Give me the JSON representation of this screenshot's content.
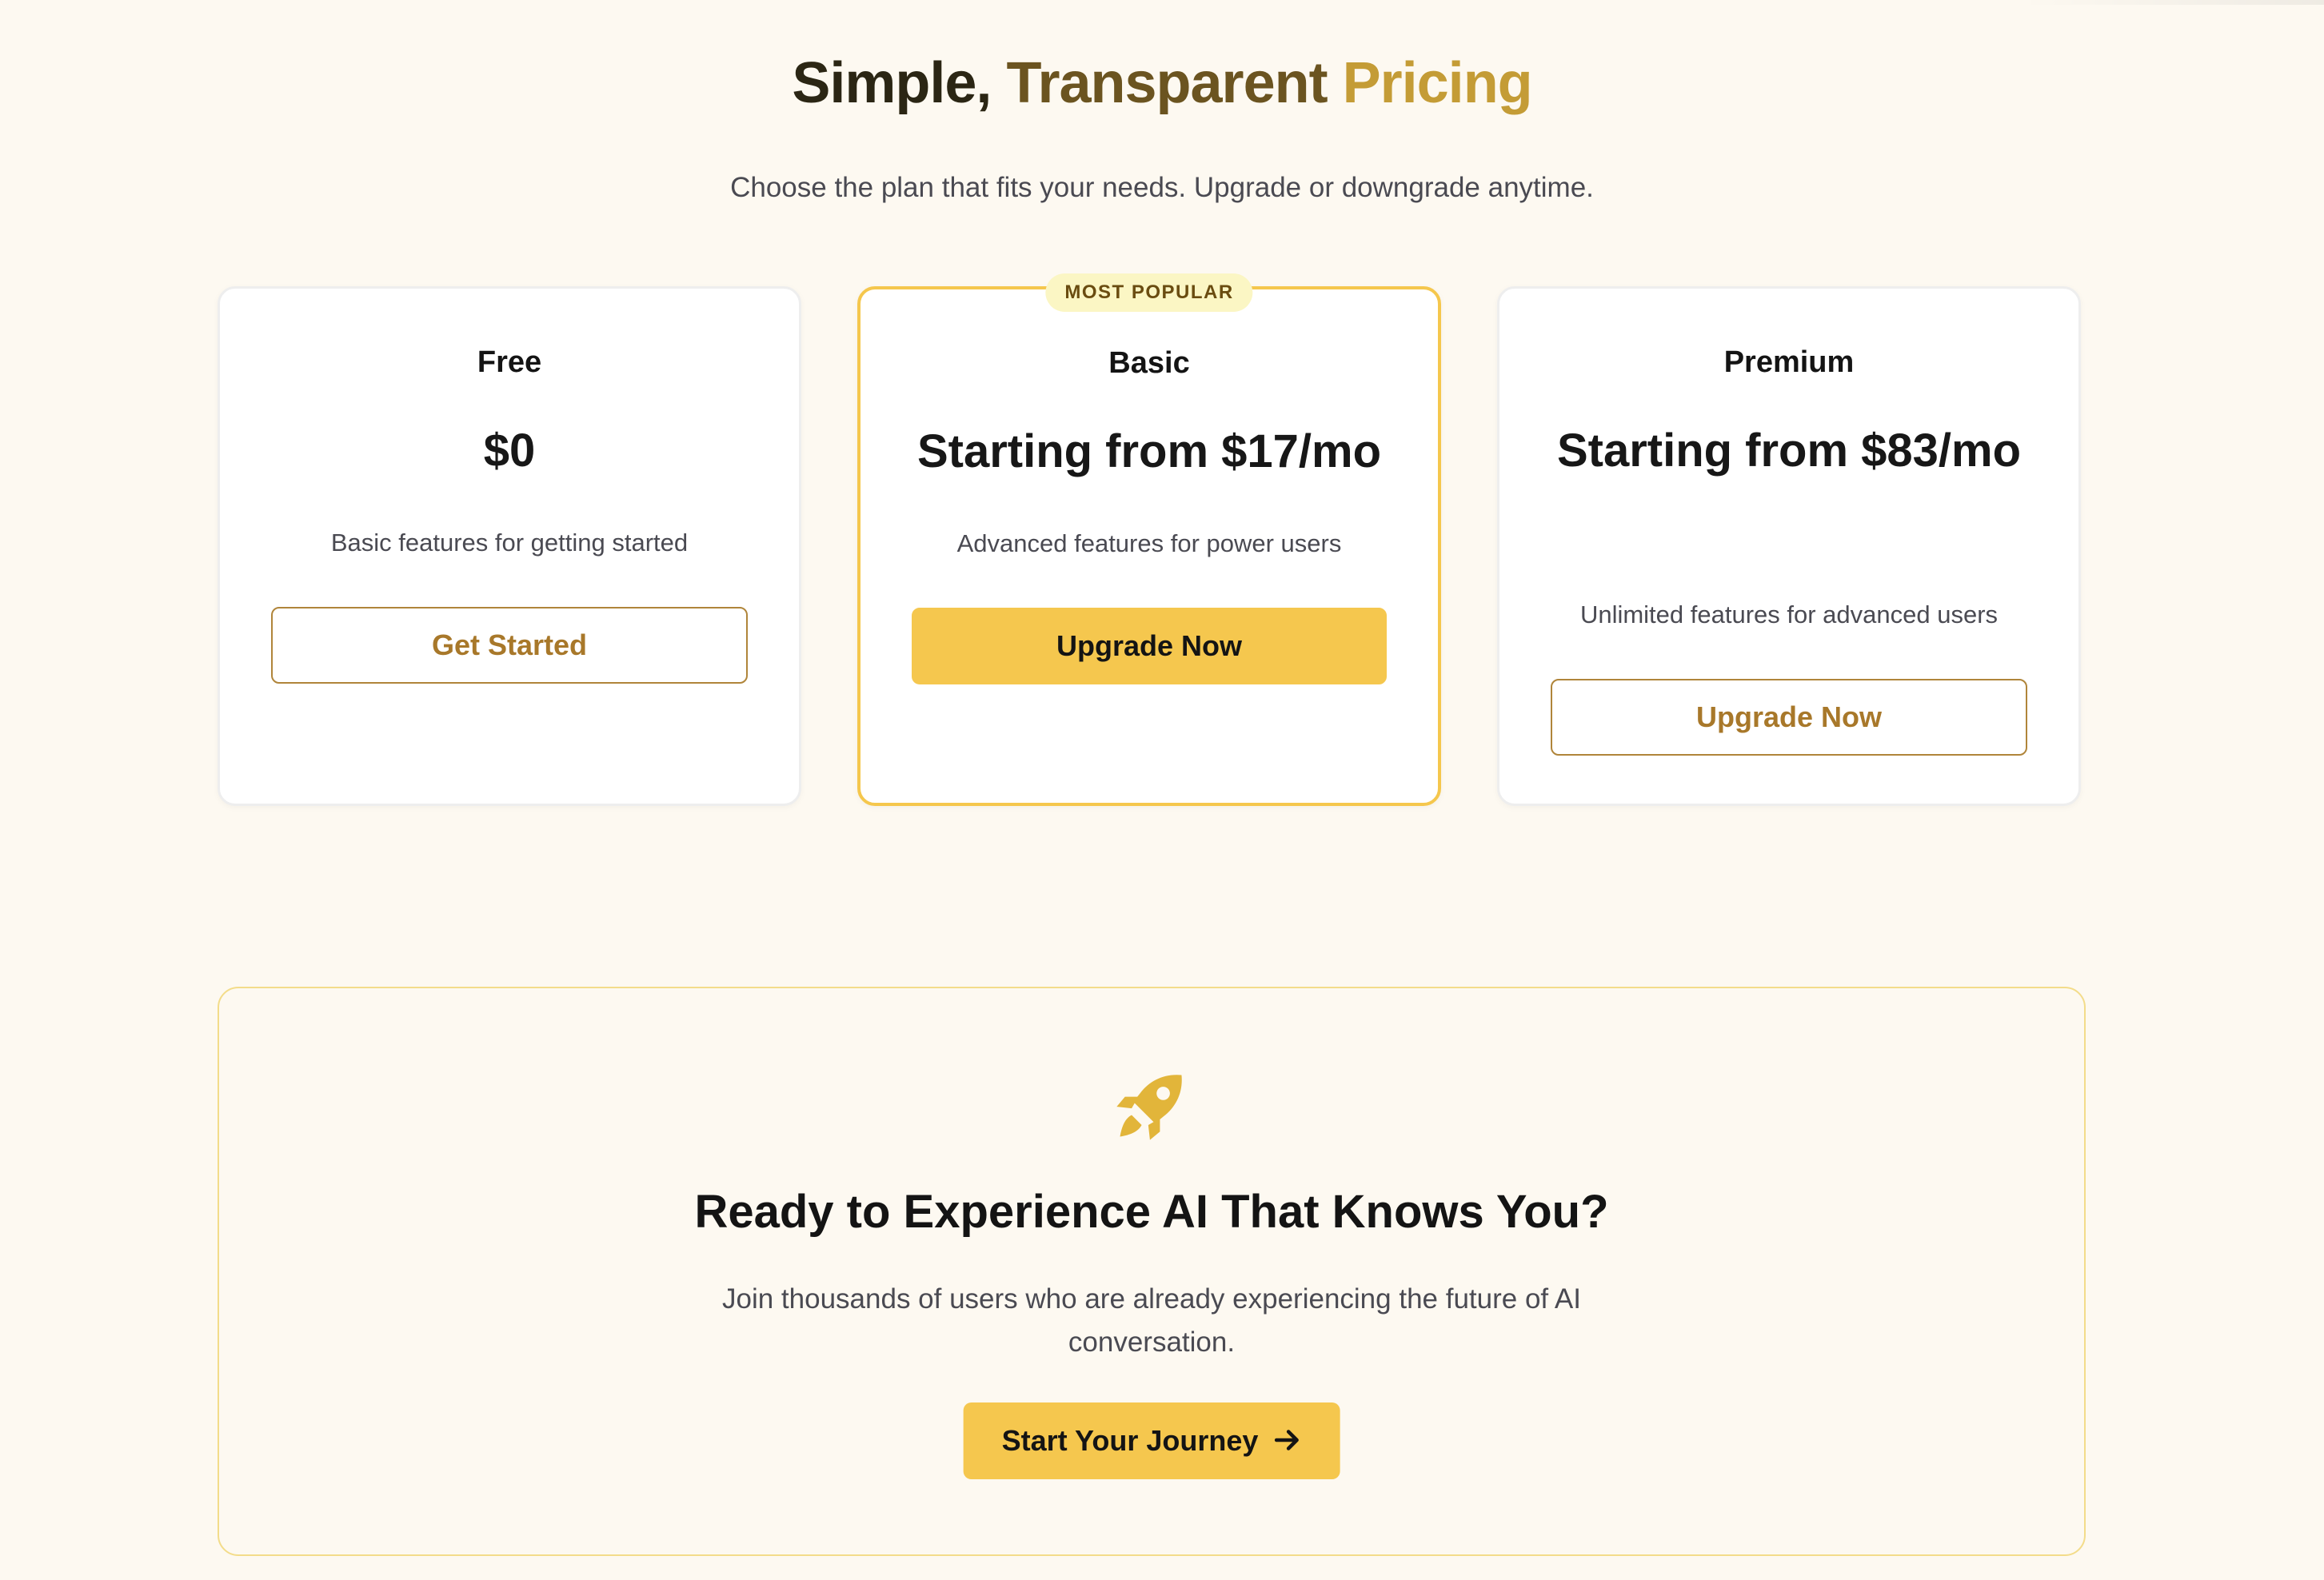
{
  "colors": {
    "background": "#fdf9f1",
    "accent": "#f5c74e",
    "accent_dark": "#a8782a",
    "title_dark": "#2b2614",
    "title_mid": "#6b5420",
    "title_light": "#c49c36",
    "badge_bg": "#fbf6c4"
  },
  "hero": {
    "title_part1": "Simple,",
    "title_part2": "Transparent",
    "title_part3": "Pricing",
    "subtitle": "Choose the plan that fits your needs. Upgrade or downgrade anytime."
  },
  "plans": [
    {
      "name": "Free",
      "price": "$0",
      "description": "Basic features for getting started",
      "button_label": "Get Started",
      "highlighted": false
    },
    {
      "name": "Basic",
      "price": "Starting from $17/mo",
      "description": "Advanced features for power users",
      "button_label": "Upgrade Now",
      "highlighted": true,
      "badge": "MOST POPULAR"
    },
    {
      "name": "Premium",
      "price": "Starting from $83/mo",
      "description": "Unlimited features for advanced users",
      "button_label": "Upgrade Now",
      "highlighted": false
    }
  ],
  "cta": {
    "icon": "rocket-icon",
    "title": "Ready to Experience AI That Knows You?",
    "subtitle": "Join thousands of users who are already experiencing the future of AI conversation.",
    "button_label": "Start Your Journey",
    "button_icon": "arrow-right-icon"
  }
}
